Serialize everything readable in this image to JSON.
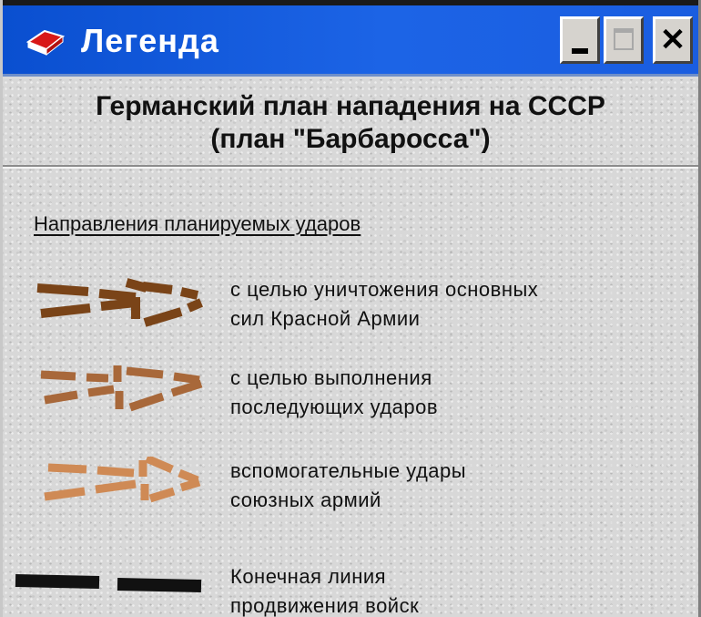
{
  "window": {
    "title": "Легенда",
    "title_color": "#ffffff",
    "titlebar_color": "#1c64e6"
  },
  "titlebar_buttons": {
    "minimize": "_",
    "maximize": "□",
    "close": "×"
  },
  "heading": {
    "line1": "Германский план нападения на СССР",
    "line2": "(план \"Барбаросса\")"
  },
  "subheading": "Направления планируемых ударов",
  "legend": [
    {
      "line1": "с целью уничтожения основных",
      "line2": "сил Красной Армии",
      "color": "#7a4418",
      "icon": "dashed-arrow-icon"
    },
    {
      "line1": "с целью выполнения",
      "line2": "последующих ударов",
      "color": "#a8683a",
      "icon": "dashed-arrow-icon"
    },
    {
      "line1": "вспомогательные удары",
      "line2": "союзных армий",
      "color": "#cf8a55",
      "icon": "dashed-arrow-icon"
    },
    {
      "line1": "Конечная линия",
      "line2": "продвижения войск",
      "color": "#111111",
      "icon": "dashed-line-icon"
    }
  ]
}
